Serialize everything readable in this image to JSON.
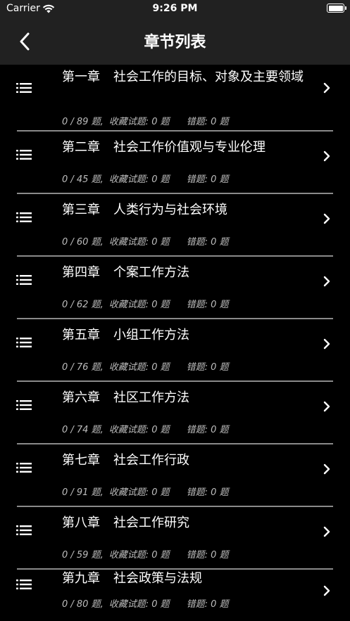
{
  "status_bar": {
    "carrier": "Carrier",
    "time": "9:26 PM"
  },
  "nav": {
    "title": "章节列表",
    "back_icon": "chevron-left-icon"
  },
  "colors": {
    "background": "#000000",
    "bar": "#212121",
    "divider": "#8a8a8a",
    "stats_text": "#bdbdbd"
  },
  "chapters": [
    {
      "num": "第一章",
      "title": "社会工作的目标、对象及主要领域",
      "count": "0 / 89 题,",
      "favorites": "收藏试题: 0 题",
      "errors": "错题: 0 题"
    },
    {
      "num": "第二章",
      "title": "社会工作价值观与专业伦理",
      "count": "0 / 45 题,",
      "favorites": "收藏试题: 0 题",
      "errors": "错题: 0 题"
    },
    {
      "num": "第三章",
      "title": "人类行为与社会环境",
      "count": "0 / 60 题,",
      "favorites": "收藏试题: 0 题",
      "errors": "错题: 0 题"
    },
    {
      "num": "第四章",
      "title": "个案工作方法",
      "count": "0 / 62 题,",
      "favorites": "收藏试题: 0 题",
      "errors": "错题: 0 题"
    },
    {
      "num": "第五章",
      "title": "小组工作方法",
      "count": "0 / 76 题,",
      "favorites": "收藏试题: 0 题",
      "errors": "错题: 0 题"
    },
    {
      "num": "第六章",
      "title": "社区工作方法",
      "count": "0 / 74 题,",
      "favorites": "收藏试题: 0 题",
      "errors": "错题: 0 题"
    },
    {
      "num": "第七章",
      "title": "社会工作行政",
      "count": "0 / 91 题,",
      "favorites": "收藏试题: 0 题",
      "errors": "错题: 0 题"
    },
    {
      "num": "第八章",
      "title": "社会工作研究",
      "count": "0 / 59 题,",
      "favorites": "收藏试题: 0 题",
      "errors": "错题: 0 题"
    },
    {
      "num": "第九章",
      "title": "社会政策与法规",
      "count": "0 / 80 题,",
      "favorites": "收藏试题: 0 题",
      "errors": "错题: 0 题"
    }
  ]
}
